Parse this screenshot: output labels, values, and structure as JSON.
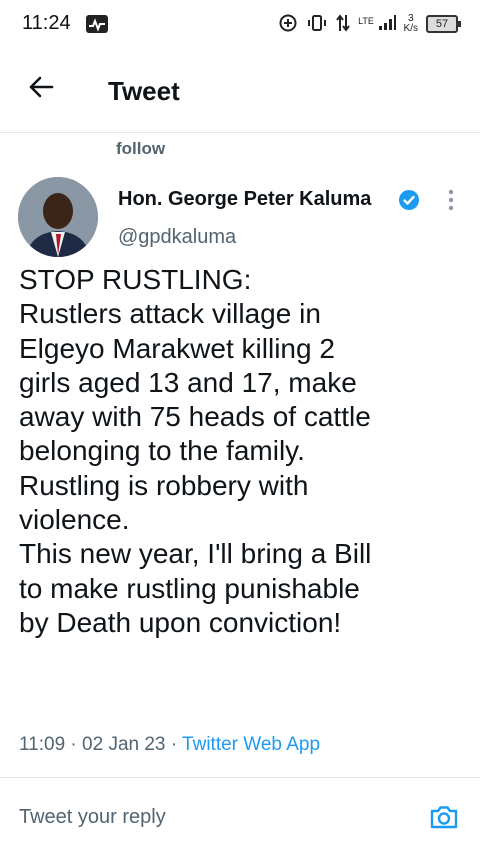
{
  "status_bar": {
    "time": "11:24",
    "network": "LTE",
    "speed_value": "3",
    "speed_unit": "K/s",
    "battery": "57"
  },
  "header": {
    "title": "Tweet",
    "back_icon": "arrow-left-icon"
  },
  "previous_tweet": {
    "follow_label": "follow"
  },
  "tweet": {
    "author_name": "Hon. George Peter Kaluma",
    "handle": "@gpdkaluma",
    "text_lines": [
      "STOP RUSTLING:",
      "Rustlers attack village in",
      "Elgeyo Marakwet killing 2",
      "girls aged 13 and 17, make",
      "away with 75 heads of cattle",
      "belonging to the family.",
      "Rustling is robbery with",
      "violence.",
      "This new year, I'll bring a Bill",
      "to make rustling punishable",
      "by Death upon conviction!"
    ],
    "time": "11:09",
    "separator": "·",
    "date": "02 Jan 23",
    "source": "Twitter Web App"
  },
  "reply": {
    "placeholder": "Tweet your reply"
  },
  "colors": {
    "accent": "#1d9bf0",
    "text": "#0f1419",
    "secondary": "#536471",
    "divider": "#e5e7ea"
  }
}
